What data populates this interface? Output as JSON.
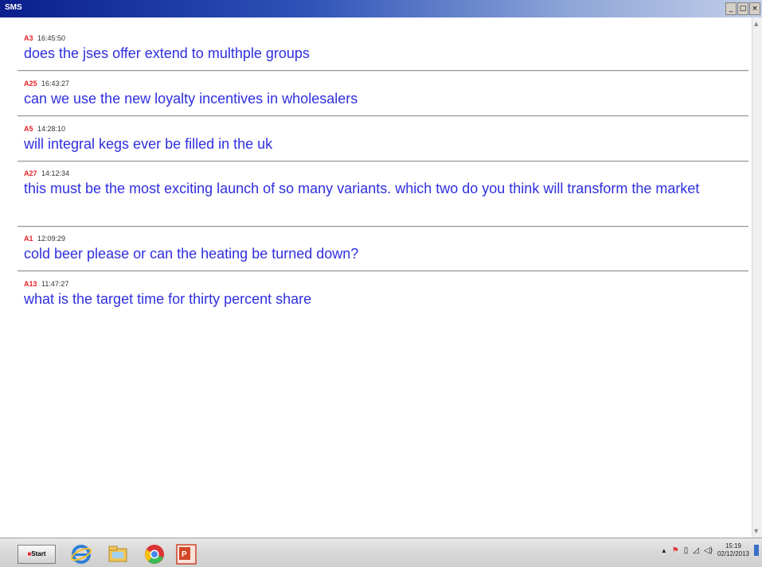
{
  "window": {
    "title": "SMS"
  },
  "messages": [
    {
      "sender": "A3",
      "time": "16:45:50",
      "text": "does the jses offer extend to multhple groups"
    },
    {
      "sender": "A25",
      "time": "16:43:27",
      "text": "can we use the new loyalty incentives in wholesalers"
    },
    {
      "sender": "A5",
      "time": "14:28:10",
      "text": "will integral kegs ever be filled in the uk"
    },
    {
      "sender": "A27",
      "time": "14:12:34",
      "text": "this must be the most exciting launch of so many variants. which two do you think will transform the market"
    },
    {
      "sender": "A1",
      "time": "12:09:29",
      "text": "cold beer please or can the heating be turned down?"
    },
    {
      "sender": "A13",
      "time": "11:47:27",
      "text": "what is the target time for thirty percent share"
    }
  ],
  "taskbar": {
    "start_label": "Start",
    "clock_time": "15:19",
    "clock_date": "02/12/2013",
    "tray_arrow": "▲",
    "icons": [
      "internet-explorer-icon",
      "file-explorer-icon",
      "chrome-icon",
      "powerpoint-icon"
    ]
  },
  "colors": {
    "sender": "#e8242a",
    "message_text": "#2f2fe0",
    "titlebar": "#0a1f8c"
  }
}
